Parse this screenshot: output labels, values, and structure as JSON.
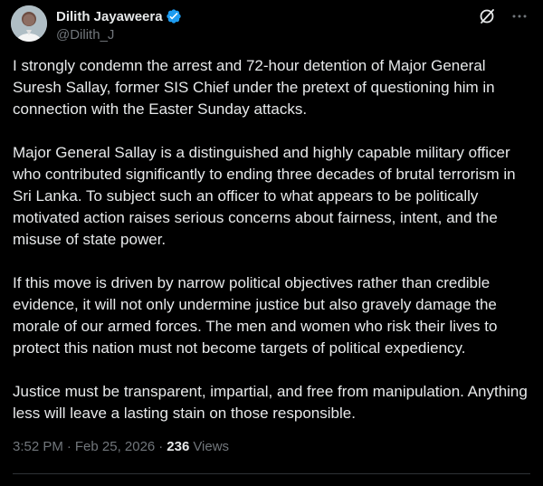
{
  "author": {
    "display_name": "Dilith Jayaweera",
    "handle": "@Dilith_J",
    "verified": true,
    "verified_color": "#1d9bf0"
  },
  "actions": {
    "grok_icon": "grok-slash-circle-icon",
    "more_icon": "more-dots-icon"
  },
  "tweet": {
    "paragraphs": [
      "I strongly condemn the arrest and 72-hour detention of Major General Suresh Sallay, former SIS Chief under the pretext of questioning him in connection with the Easter Sunday attacks.",
      "Major General Sallay is a distinguished and highly capable military officer who contributed significantly to ending three decades of brutal terrorism in Sri Lanka. To subject such an officer to what appears to be politically motivated action raises serious concerns about fairness, intent, and the misuse of state power.",
      "If this move is driven by narrow political objectives rather than credible evidence, it will not only undermine justice but also gravely damage the morale of our armed forces. The men and women who risk their lives to protect this nation must not become targets of political expediency.",
      "Justice must be transparent, impartial, and free from manipulation. Anything less will leave a lasting stain on those responsible."
    ]
  },
  "meta": {
    "time": "3:52 PM",
    "date": "Feb 25, 2026",
    "separator": "·",
    "views_count": "236",
    "views_label": "Views"
  },
  "colors": {
    "background": "#000000",
    "text_primary": "#e7e9ea",
    "text_secondary": "#71767b",
    "divider": "#2f3336"
  }
}
